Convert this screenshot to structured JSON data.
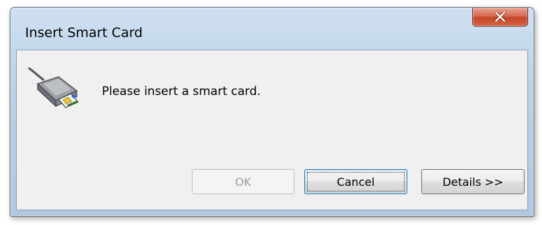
{
  "window": {
    "title": "Insert Smart Card",
    "close_label": "Close"
  },
  "dialog": {
    "icon": "smart-card-reader-icon",
    "message": "Please insert a smart card."
  },
  "buttons": {
    "ok": {
      "label": "OK",
      "enabled": false
    },
    "cancel": {
      "label": "Cancel",
      "enabled": true,
      "focused": true
    },
    "details": {
      "label": "Details >>",
      "enabled": true
    }
  },
  "colors": {
    "frame": "#bcd1e8",
    "client": "#f0f0f0",
    "close_button": "#c4452a",
    "disabled_text": "#a0a0a0"
  }
}
